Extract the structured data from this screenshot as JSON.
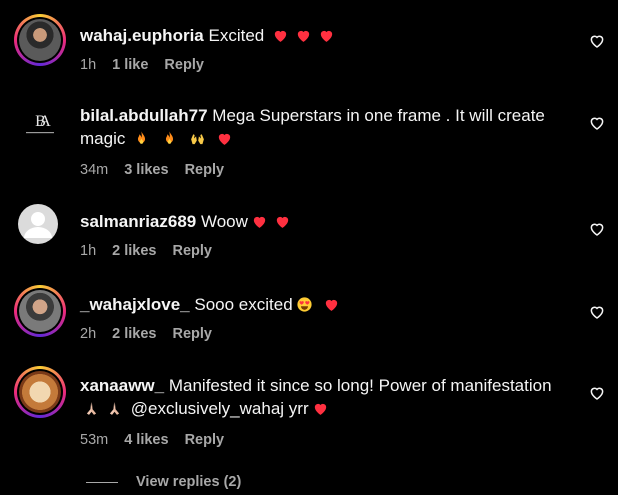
{
  "comments": [
    {
      "username": "wahaj.euphoria",
      "text": "Excited",
      "emojis_after": [
        "red-heart",
        "red-heart",
        "red-heart"
      ],
      "time": "1h",
      "likes": "1 like",
      "reply": "Reply",
      "avatar": "profile-photo-ring"
    },
    {
      "username": "bilal.abdullah77",
      "text_line1": "Mega Superstars in one frame . It will create",
      "text_line2": "magic",
      "emojis_after": [
        "fire",
        "fire",
        "raising-hands",
        "red-heart"
      ],
      "time": "34m",
      "likes": "3 likes",
      "reply": "Reply",
      "avatar_logo_text": "BA"
    },
    {
      "username": "salmanriaz689",
      "text": "Woow",
      "emojis_after": [
        "red-heart",
        "red-heart"
      ],
      "time": "1h",
      "likes": "2 likes",
      "reply": "Reply",
      "avatar": "default-avatar"
    },
    {
      "username": "_wahajxlove_",
      "text": "Sooo excited",
      "emojis_after": [
        "heart-eyes",
        "red-heart"
      ],
      "time": "2h",
      "likes": "2 likes",
      "reply": "Reply",
      "avatar": "profile-photo-ring"
    },
    {
      "username": "xanaaww_",
      "text_line1": "Manifested it since so long! Power of manifestation",
      "text_line2": "@exclusively_wahaj yrr",
      "emojis_line2_before": [
        "praying-hands",
        "praying-hands"
      ],
      "emojis_after": [
        "red-heart"
      ],
      "time": "53m",
      "likes": "4 likes",
      "reply": "Reply",
      "avatar": "profile-photo-ring"
    }
  ],
  "view_replies": "View replies (2)",
  "colors": {
    "background": "#000000",
    "text": "#f5f5f5",
    "muted": "#a8a8a8",
    "heart": "#ff3040"
  }
}
